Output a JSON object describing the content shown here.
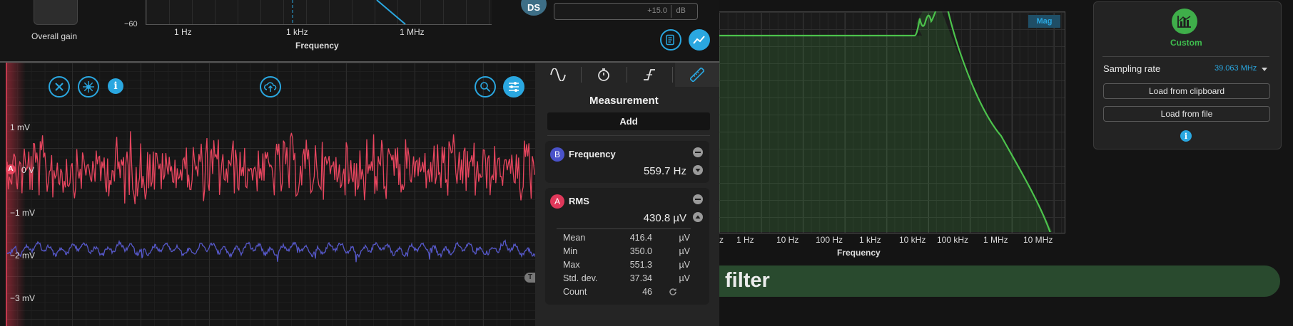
{
  "top_left": {
    "overall_gain_label": "Overall gain",
    "y_tick_neg60": "−60",
    "x_ticks": [
      "1 Hz",
      "1 kHz",
      "1 MHz"
    ],
    "x_label": "Frequency"
  },
  "top_mid": {
    "avatar_text": "DS",
    "gain_field_value": "+15.0",
    "gain_field_unit": "dB"
  },
  "scope": {
    "y_ticks": [
      "1 mV",
      "0 V",
      "−1 mV",
      "−2 mV",
      "−3 mV"
    ],
    "channel_a_marker": "A",
    "trigger_marker": "T",
    "colors": {
      "channel_a": "#e8465f",
      "channel_b": "#5658c9",
      "accent": "#2aa7e0"
    }
  },
  "measurement_panel": {
    "title": "Measurement",
    "add_label": "Add",
    "tabs": [
      "sine-wave-icon",
      "stopwatch-icon",
      "edge-trigger-icon",
      "ruler-icon"
    ],
    "items": [
      {
        "channel": "B",
        "name": "Frequency",
        "value": "559.7 Hz",
        "color": "#4a52c9"
      },
      {
        "channel": "A",
        "name": "RMS",
        "value": "430.8 µV",
        "color": "#e0385a"
      }
    ],
    "stats": [
      {
        "label": "Mean",
        "value": "416.4",
        "unit": "µV"
      },
      {
        "label": "Min",
        "value": "350.0",
        "unit": "µV"
      },
      {
        "label": "Max",
        "value": "551.3",
        "unit": "µV"
      },
      {
        "label": "Std. dev.",
        "value": "37.34",
        "unit": "µV"
      },
      {
        "label": "Count",
        "value": "46",
        "unit": ""
      }
    ]
  },
  "bode": {
    "badge": "Mag",
    "x_ticks": [
      "z",
      "1 Hz",
      "10 Hz",
      "100 Hz",
      "1 kHz",
      "10 kHz",
      "100 kHz",
      "1 MHz",
      "10 MHz"
    ],
    "x_label": "Frequency",
    "curve_color": "#4cc34c"
  },
  "banner": {
    "text": "filter"
  },
  "side_panel": {
    "preset_label": "Custom",
    "sampling_rate_label": "Sampling rate",
    "sampling_rate_value": "39.063 MHz",
    "load_clipboard_label": "Load from clipboard",
    "load_file_label": "Load from file"
  }
}
